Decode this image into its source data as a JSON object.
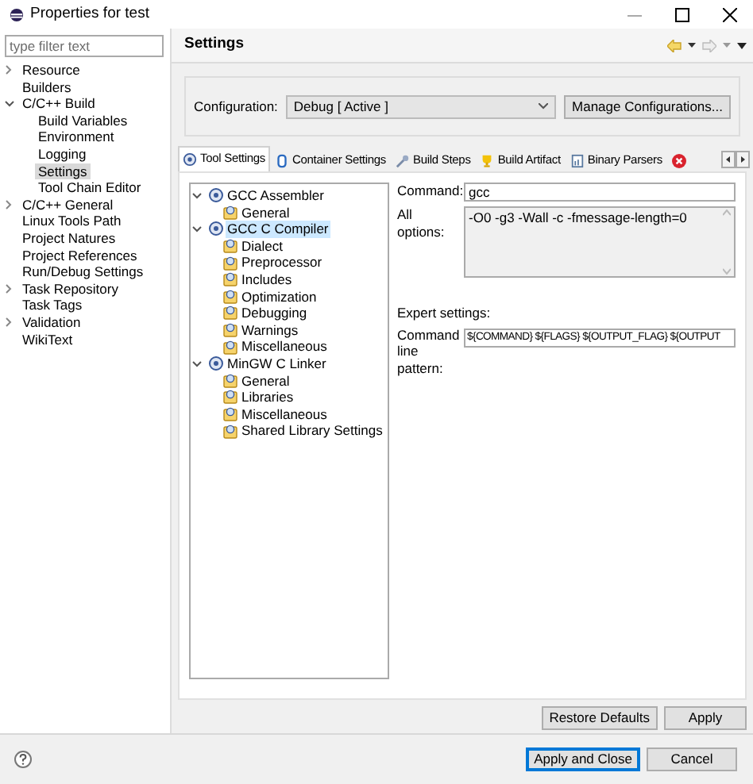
{
  "window": {
    "title": "Properties for test"
  },
  "filter": {
    "placeholder": "type filter text"
  },
  "sidebar": {
    "items": [
      {
        "label": "Resource",
        "expanded": false,
        "selected": false
      },
      {
        "label": "Builders",
        "selected": false
      },
      {
        "label": "C/C++ Build",
        "expanded": true,
        "selected": false,
        "children": [
          {
            "label": "Build Variables",
            "selected": false
          },
          {
            "label": "Environment",
            "selected": false
          },
          {
            "label": "Logging",
            "selected": false
          },
          {
            "label": "Settings",
            "selected": true
          },
          {
            "label": "Tool Chain Editor",
            "selected": false
          }
        ]
      },
      {
        "label": "C/C++ General",
        "expanded": false,
        "selected": false
      },
      {
        "label": "Linux Tools Path",
        "selected": false
      },
      {
        "label": "Project Natures",
        "selected": false
      },
      {
        "label": "Project References",
        "selected": false
      },
      {
        "label": "Run/Debug Settings",
        "selected": false
      },
      {
        "label": "Task Repository",
        "expanded": false,
        "selected": false
      },
      {
        "label": "Task Tags",
        "selected": false
      },
      {
        "label": "Validation",
        "expanded": false,
        "selected": false
      },
      {
        "label": "WikiText",
        "selected": false
      }
    ]
  },
  "header": {
    "title": "Settings"
  },
  "configuration": {
    "label": "Configuration:",
    "value": "Debug  [ Active ]",
    "button": "Manage Configurations..."
  },
  "tabs": [
    {
      "label": "Tool Settings",
      "selected": true
    },
    {
      "label": "Container Settings",
      "selected": false
    },
    {
      "label": "Build Steps",
      "selected": false
    },
    {
      "label": "Build Artifact",
      "selected": false
    },
    {
      "label": "Binary Parsers",
      "selected": false
    }
  ],
  "tool_tree": [
    {
      "label": "GCC Assembler",
      "expanded": true,
      "selected": false,
      "children": [
        {
          "label": "General",
          "selected": false
        }
      ]
    },
    {
      "label": "GCC C Compiler",
      "expanded": true,
      "selected": true,
      "children": [
        {
          "label": "Dialect",
          "selected": false
        },
        {
          "label": "Preprocessor",
          "selected": false
        },
        {
          "label": "Includes",
          "selected": false
        },
        {
          "label": "Optimization",
          "selected": false
        },
        {
          "label": "Debugging",
          "selected": false
        },
        {
          "label": "Warnings",
          "selected": false
        },
        {
          "label": "Miscellaneous",
          "selected": false
        }
      ]
    },
    {
      "label": "MinGW C Linker",
      "expanded": true,
      "selected": false,
      "children": [
        {
          "label": "General",
          "selected": false
        },
        {
          "label": "Libraries",
          "selected": false
        },
        {
          "label": "Miscellaneous",
          "selected": false
        },
        {
          "label": "Shared Library Settings",
          "selected": false
        }
      ]
    }
  ],
  "form": {
    "command_label": "Command:",
    "command": "gcc",
    "all_options_label": "All options:",
    "all_options": "-O0 -g3 -Wall -c -fmessage-length=0",
    "expert_label": "Expert settings:",
    "pattern_label": "Command line pattern:",
    "pattern": "${COMMAND} ${FLAGS} ${OUTPUT_FLAG} ${OUTPUT"
  },
  "page_buttons": [
    "Restore Defaults",
    "Apply"
  ],
  "dialog_buttons": [
    {
      "label": "Apply and Close",
      "default": true
    },
    {
      "label": "Cancel",
      "default": false
    }
  ]
}
